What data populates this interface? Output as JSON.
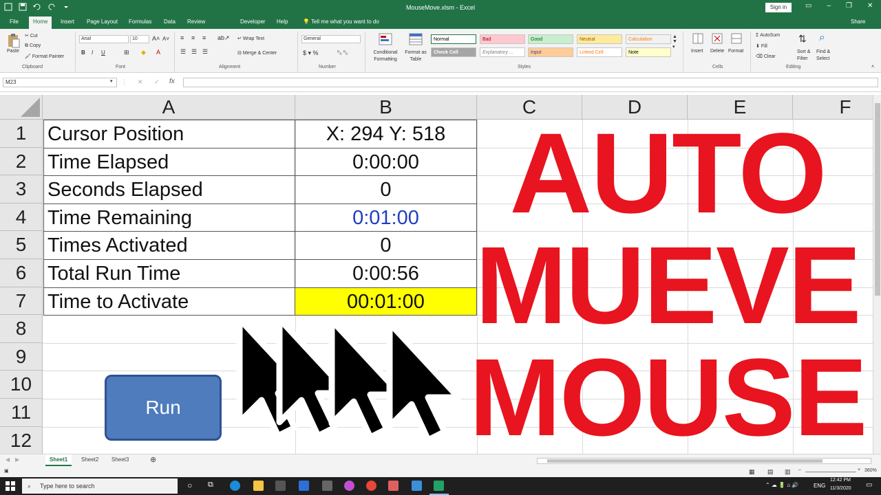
{
  "window": {
    "title": "MouseMove.xlsm  -  Excel",
    "signin": "Sign in"
  },
  "tabs": [
    "File",
    "Home",
    "Insert",
    "Page Layout",
    "Formulas",
    "Data",
    "Review",
    "Developer",
    "Help"
  ],
  "tellme": "Tell me what you want to do",
  "share": "Share",
  "ribbon": {
    "clipboard": {
      "paste": "Paste",
      "cut": "Cut",
      "copy": "Copy",
      "format_painter": "Format Painter",
      "label": "Clipboard"
    },
    "font": {
      "name": "Arial",
      "size": "10",
      "label": "Font"
    },
    "alignment": {
      "wrap": "Wrap Text",
      "merge": "Merge & Center",
      "label": "Alignment"
    },
    "number": {
      "format": "General",
      "label": "Number"
    },
    "styles": {
      "conditional": "Conditional Formatting",
      "format_table": "Format as Table",
      "cells": [
        {
          "name": "Normal",
          "bg": "#ffffff",
          "fg": "#000000"
        },
        {
          "name": "Bad",
          "bg": "#ffc7ce",
          "fg": "#9c0006"
        },
        {
          "name": "Good",
          "bg": "#c6efce",
          "fg": "#006100"
        },
        {
          "name": "Neutral",
          "bg": "#ffeb9c",
          "fg": "#9c5700"
        },
        {
          "name": "Calculation",
          "bg": "#f2f2f2",
          "fg": "#fa7d00"
        },
        {
          "name": "Check Cell",
          "bg": "#a5a5a5",
          "fg": "#ffffff"
        },
        {
          "name": "Explanatory ...",
          "bg": "#ffffff",
          "fg": "#7f7f7f"
        },
        {
          "name": "Input",
          "bg": "#ffcc99",
          "fg": "#3f3f76"
        },
        {
          "name": "Linked Cell",
          "bg": "#ffffff",
          "fg": "#fa7d00"
        },
        {
          "name": "Note",
          "bg": "#ffffcc",
          "fg": "#000000"
        }
      ],
      "label": "Styles"
    },
    "cells": {
      "insert": "Insert",
      "delete": "Delete",
      "format": "Format",
      "label": "Cells"
    },
    "editing": {
      "autosum": "AutoSum",
      "fill": "Fill",
      "clear": "Clear",
      "sort": "Sort & Filter",
      "find": "Find & Select",
      "label": "Editing"
    }
  },
  "formula_bar": {
    "name_box": "M23",
    "fx": "fx",
    "value": ""
  },
  "columns": [
    "A",
    "B",
    "C",
    "D",
    "E",
    "F"
  ],
  "rows": [
    "1",
    "2",
    "3",
    "4",
    "5",
    "6",
    "7",
    "8",
    "9",
    "10",
    "11",
    "12"
  ],
  "table": [
    {
      "label": "Cursor Position",
      "value": "X: 294 Y: 518"
    },
    {
      "label": "Time Elapsed",
      "value": "0:00:00"
    },
    {
      "label": "Seconds Elapsed",
      "value": "0"
    },
    {
      "label": "Time Remaining",
      "value": "0:01:00"
    },
    {
      "label": "Times Activated",
      "value": "0"
    },
    {
      "label": "Total Run Time",
      "value": "0:00:56"
    },
    {
      "label": "Time to Activate",
      "value": "00:01:00"
    }
  ],
  "overlay": {
    "line1": "AUTO",
    "line2": "MUEVE",
    "line3": "MOUSE",
    "color": "#e8141f"
  },
  "run_button": "Run",
  "sheets": [
    "Sheet1",
    "Sheet2",
    "Sheet3"
  ],
  "status": {
    "zoom": "360%"
  },
  "taskbar": {
    "search": "Type here to search",
    "lang": "ENG",
    "time": "12:42 PM",
    "date": "11/3/2020"
  }
}
